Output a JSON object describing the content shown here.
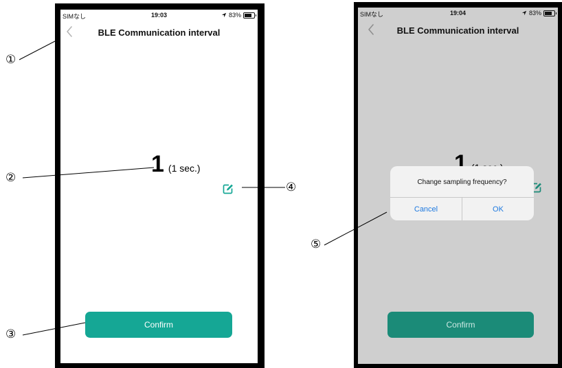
{
  "left_phone": {
    "status": {
      "carrier": "SIMなし",
      "time": "19:03",
      "battery": "83%",
      "battery_level": 0.83
    },
    "nav": {
      "title": "BLE Communication interval",
      "back_icon": "chevron-left-icon"
    },
    "value": {
      "number": "1",
      "unit": "(1 sec.)"
    },
    "edit_icon": "edit-pencil-icon",
    "confirm_label": "Confirm"
  },
  "right_phone": {
    "status": {
      "carrier": "SIMなし",
      "time": "19:04",
      "battery": "83%",
      "battery_level": 0.83
    },
    "nav": {
      "title": "BLE Communication interval",
      "back_icon": "chevron-left-icon"
    },
    "value": {
      "number": "1",
      "unit": "(1 sec.)"
    },
    "edit_icon": "edit-pencil-icon",
    "confirm_label": "Confirm",
    "dialog": {
      "message": "Change sampling frequency?",
      "cancel_label": "Cancel",
      "ok_label": "OK"
    }
  },
  "callouts": [
    "①",
    "②",
    "③",
    "④",
    "⑤"
  ],
  "colors": {
    "accent": "#15a795",
    "accent_dim": "#1b8b78",
    "overlay_bg": "#cfcfcf",
    "dialog_link": "#1f7ae0"
  }
}
